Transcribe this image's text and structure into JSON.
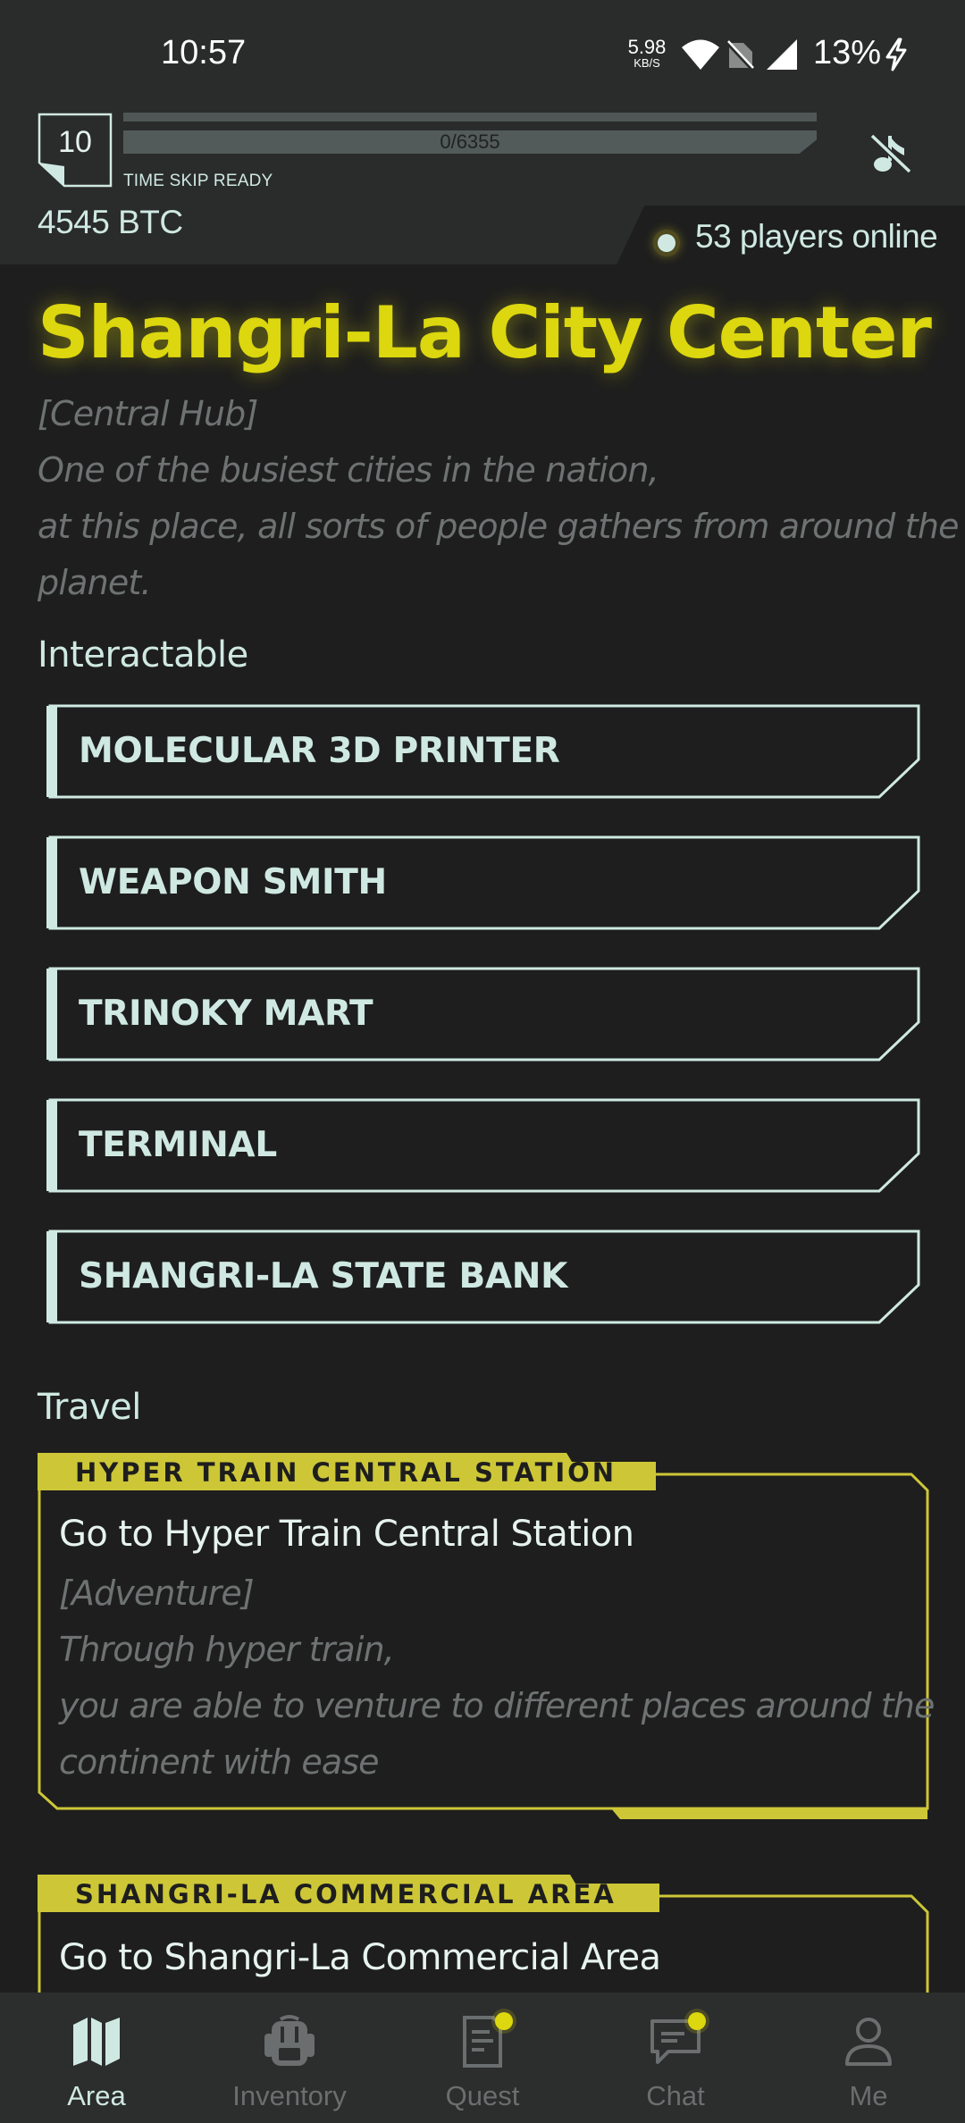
{
  "status_bar": {
    "time": "10:57",
    "net_speed_value": "5.98",
    "net_speed_unit": "KB/S",
    "battery": "13%"
  },
  "header": {
    "level": "10",
    "xp_text": "0/6355",
    "xp_progress": 0,
    "time_skip_label": "TIME SKIP READY",
    "balance": "4545 BTC",
    "players_online": "53 players online"
  },
  "area": {
    "title": "Shangri-La City Center",
    "tag": "[Central Hub]",
    "description_lines": [
      "One of the busiest cities in the nation,",
      "at this place, all sorts of people gathers from around the",
      "planet."
    ]
  },
  "interactable": {
    "heading": "Interactable",
    "items": [
      "MOLECULAR 3D PRINTER",
      "WEAPON SMITH",
      "TRINOKY MART",
      "TERMINAL",
      "SHANGRI-LA STATE BANK"
    ]
  },
  "travel": {
    "heading": "Travel",
    "cards": [
      {
        "tab": "HYPER TRAIN CENTRAL STATION",
        "title": "Go to Hyper Train Central Station",
        "tag": "[Adventure]",
        "description_lines": [
          "Through hyper train,",
          "you are able to venture to different places around the",
          "continent with ease"
        ]
      },
      {
        "tab": "SHANGRI-LA COMMERCIAL AREA",
        "title": "Go to Shangri-La Commercial Area"
      }
    ]
  },
  "bottom_nav": {
    "items": [
      {
        "label": "Area",
        "icon": "map-icon",
        "active": true,
        "badge": false
      },
      {
        "label": "Inventory",
        "icon": "backpack-icon",
        "active": false,
        "badge": false
      },
      {
        "label": "Quest",
        "icon": "quest-document-icon",
        "active": false,
        "badge": true
      },
      {
        "label": "Chat",
        "icon": "chat-bubble-icon",
        "active": false,
        "badge": true
      },
      {
        "label": "Me",
        "icon": "user-icon",
        "active": false,
        "badge": false
      }
    ]
  },
  "colors": {
    "accent_yellow": "#dcd70e",
    "mint": "#cfe9e2",
    "background": "#1e1e1e",
    "panel": "#2a2b2b",
    "muted_text": "#6e7272"
  }
}
